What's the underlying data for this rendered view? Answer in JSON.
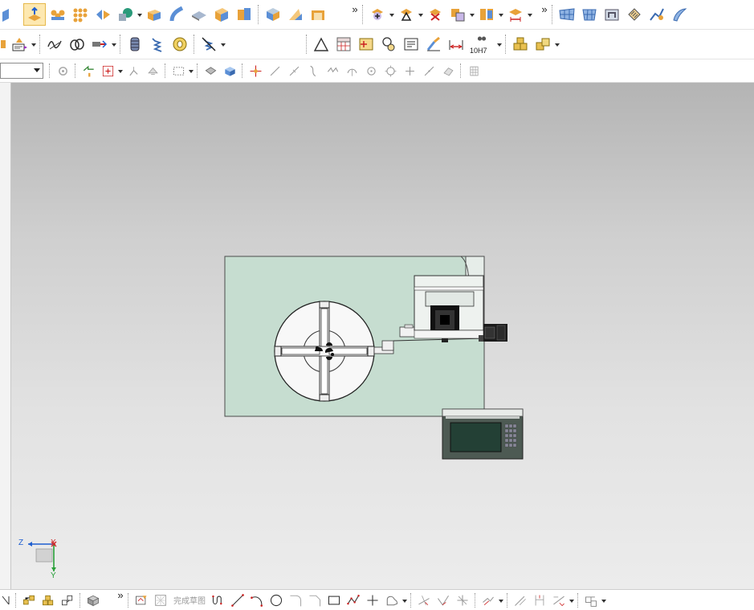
{
  "toolbar_more_glyph": "»",
  "tolerance_fit_label": "10H7",
  "finish_sketch_label": "完成草图",
  "triad": {
    "z_label": "Z",
    "x_label": "X",
    "y_label": "Y"
  },
  "colors": {
    "viewport_top": "#b4b4b4",
    "viewport_bottom": "#ececec",
    "plate_fill": "#c6ddd0",
    "axis_z": "#1f5fd0",
    "axis_x": "#d02828",
    "axis_y": "#28a038",
    "icon_orange": "#e8a23a",
    "icon_blue": "#5b8fd6"
  }
}
